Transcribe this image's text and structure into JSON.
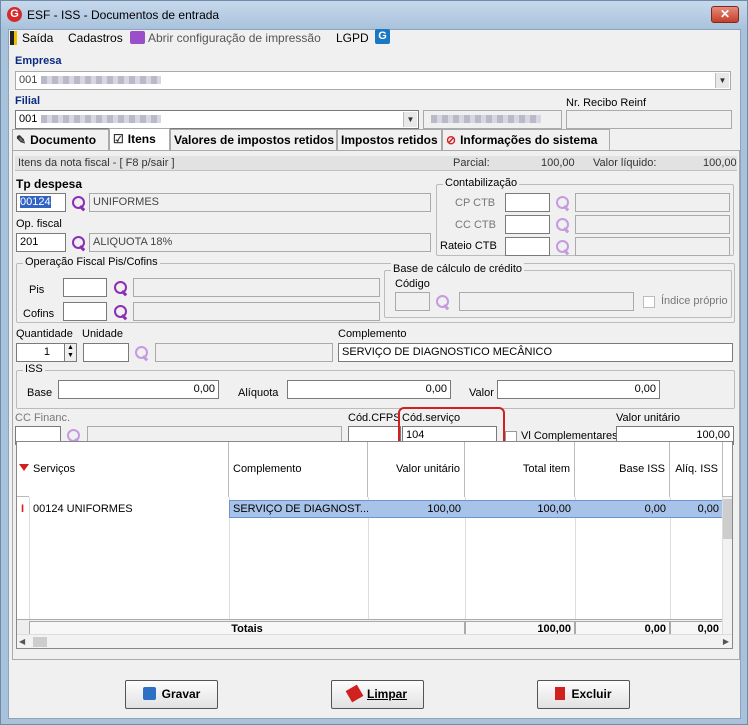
{
  "window": {
    "title": "ESF - ISS - Documentos de entrada",
    "logo": "G",
    "close": "✕"
  },
  "menu": {
    "exit": "Saída",
    "cadastros": "Cadastros",
    "print_config": "Abrir configuração de impressão",
    "lgpd": "LGPD"
  },
  "empresa": {
    "label": "Empresa",
    "code": "001"
  },
  "filial": {
    "label": "Filial",
    "code": "001",
    "recibo_label": "Nr. Recibo Reinf"
  },
  "tabs": [
    "Documento",
    "Itens",
    "Valores de impostos retidos",
    "Impostos retidos",
    "Informações do sistema"
  ],
  "band": {
    "left": "Itens da nota fiscal - [ F8 p/sair ]",
    "parcial_label": "Parcial:",
    "parcial_value": "100,00",
    "liquido_label": "Valor líquido:",
    "liquido_value": "100,00"
  },
  "tp_despesa": {
    "label": "Tp despesa",
    "code": "00124",
    "desc": "UNIFORMES"
  },
  "op_fiscal": {
    "label": "Op. fiscal",
    "code": "201",
    "desc": "ALIQUOTA 18%"
  },
  "contab": {
    "title": "Contabilização",
    "cp": "CP CTB",
    "cc": "CC CTB",
    "rateio": "Rateio CTB"
  },
  "pis_cofins": {
    "title": "Operação Fiscal Pis/Cofins",
    "pis": "Pis",
    "cofins": "Cofins"
  },
  "credito": {
    "title": "Base de cálculo de crédito",
    "codigo": "Código",
    "indice": "Índice próprio"
  },
  "qty": {
    "label": "Quantidade",
    "value": "1",
    "unidade_label": "Unidade",
    "complemento_label": "Complemento",
    "complemento_value": "SERVIÇO DE DIAGNOSTICO MECÂNICO"
  },
  "iss": {
    "title": "ISS",
    "base_label": "Base",
    "base_value": "0,00",
    "aliq_label": "Alíquota",
    "aliq_value": "0,00",
    "valor_label": "Valor",
    "valor_value": "0,00"
  },
  "misc": {
    "cc_financ": "CC Financ.",
    "cfps_label": "Cód.CFPS",
    "servico_label": "Cód.serviço",
    "servico_value": "104",
    "vl_compl": "Vl Complementares",
    "unit_label": "Valor unitário",
    "unit_value": "100,00"
  },
  "grid": {
    "headers": [
      "Serviços",
      "Complemento",
      "Valor unitário",
      "Total item",
      "Base ISS",
      "Alíq. ISS"
    ],
    "row": [
      "00124 UNIFORMES",
      "SERVIÇO DE DIAGNOST...",
      "100,00",
      "100,00",
      "0,00",
      "0,00"
    ],
    "totals_label": "Totais",
    "totals": [
      "100,00",
      "0,00",
      "0,00"
    ]
  },
  "buttons": {
    "save": "Gravar",
    "clear": "Limpar",
    "delete": "Excluir"
  }
}
